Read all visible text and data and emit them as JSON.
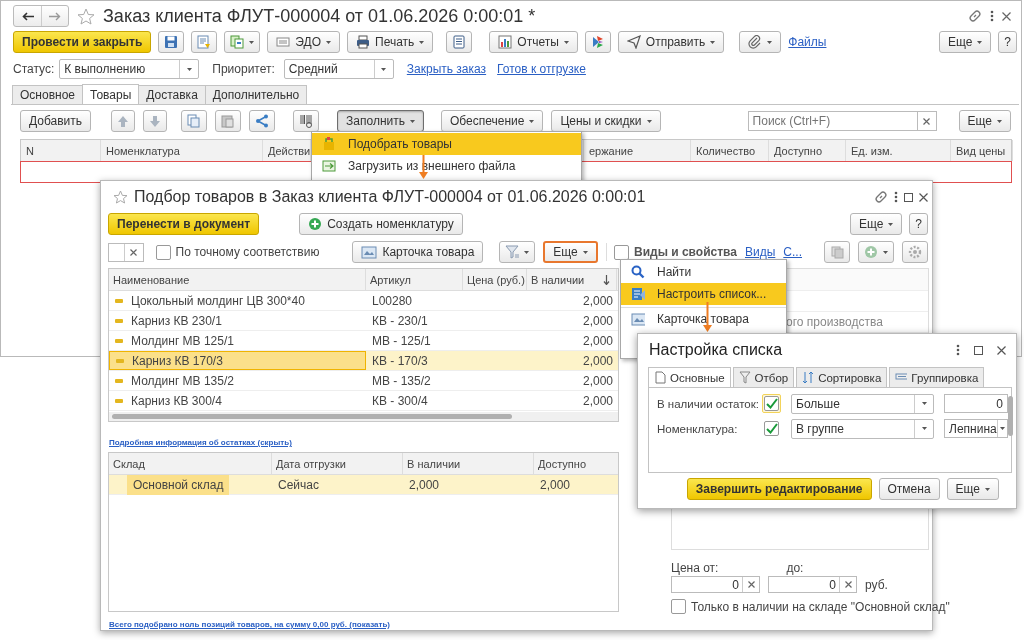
{
  "main": {
    "title": "Заказ клиента ФЛУТ-000004 от 01.06.2026 0:00:01 *",
    "toolbar": {
      "post": "Провести и закрыть",
      "edo": "ЭДО",
      "print": "Печать",
      "reports": "Отчеты",
      "send": "Отправить",
      "files": "Файлы",
      "more": "Еще",
      "help": "?"
    },
    "status": {
      "label": "Статус:",
      "value": "К выполнению"
    },
    "priority": {
      "label": "Приоритет:",
      "value": "Средний"
    },
    "links": [
      "Закрыть заказ",
      "Готов к отгрузке"
    ],
    "tabs": [
      {
        "label": "Основное",
        "selected": false
      },
      {
        "label": "Товары",
        "selected": true
      },
      {
        "label": "Доставка",
        "selected": false
      },
      {
        "label": "Дополнительно",
        "selected": false
      }
    ],
    "goods_toolbar": {
      "add": "Добавить",
      "fill": {
        "label": "Заполнить",
        "pressed": true
      },
      "supply": "Обеспечение",
      "prices": "Цены и скидки",
      "search_placeholder": "Поиск (Ctrl+F)",
      "more": "Еще"
    },
    "columns": [
      "N",
      "Номенклатура",
      "Действи",
      "ержание",
      "Количество",
      "Доступно",
      "Ед. изм.",
      "Вид цены"
    ]
  },
  "fill_menu": [
    {
      "label": "Подобрать товары",
      "selected": true
    },
    {
      "label": "Загрузить из внешнего файла",
      "selected": false
    }
  ],
  "picker": {
    "title": "Подбор товаров в Заказ клиента ФЛУТ-000004 от 01.06.2026 0:00:01",
    "transfer": "Перенести в документ",
    "create": "Создать номенклатуру",
    "more": "Еще",
    "help": "?",
    "exact_match": {
      "label": "По точному соответствию",
      "checked": false
    },
    "card": "Карточка товара",
    "list_more": {
      "label": "Еще",
      "pressed": true
    },
    "kinds": {
      "label": "Виды и свойства",
      "checked": false
    },
    "kinds_links": [
      "Виды",
      "С..."
    ],
    "columns": [
      "Наименование",
      "Артикул",
      "Цена (руб.)",
      "В наличии"
    ],
    "rows": [
      {
        "name": "Цокольный молдинг ЦВ 300*40",
        "article": "L00280",
        "stock": "2,000",
        "selected": false
      },
      {
        "name": "Карниз КВ 230/1",
        "article": "КВ - 230/1",
        "stock": "2,000",
        "selected": false
      },
      {
        "name": "Молдинг МВ 125/1",
        "article": "МВ - 125/1",
        "stock": "2,000",
        "selected": false
      },
      {
        "name": "Карниз КВ 170/3",
        "article": "КВ - 170/3",
        "stock": "2,000",
        "selected": true
      },
      {
        "name": "Молдинг МВ 135/2",
        "article": "МВ - 135/2",
        "stock": "2,000",
        "selected": false
      },
      {
        "name": "Карниз КВ 300/4",
        "article": "КВ - 300/4",
        "stock": "2,000",
        "selected": false
      }
    ],
    "stock_link": "Подробная информация об остатках (скрыть)",
    "stock_columns": [
      "Склад",
      "Дата отгрузки",
      "В наличии",
      "Доступно"
    ],
    "stock_rows": [
      {
        "cells": [
          "Основной склад",
          "Сейчас",
          "2,000",
          "2,000"
        ],
        "selected": true
      }
    ],
    "total_link": "Всего подобрано ноль позиций товаров, на сумму 0,00 руб. (показать)",
    "properties_text": "ого производства",
    "price_from": {
      "label": "Цена от:",
      "value": "0"
    },
    "price_to": {
      "label": "до:",
      "value": "0"
    },
    "currency": "руб.",
    "only_in_stock": {
      "label": "Только в наличии на складе \"Основной склад\"",
      "checked": false
    }
  },
  "more_menu": [
    {
      "label": "Найти",
      "selected": false
    },
    {
      "label": "Настроить список...",
      "selected": true
    },
    {
      "label": "Карточка товара",
      "selected": false
    }
  ],
  "settings": {
    "title": "Настройка списка",
    "tabs": [
      {
        "label": "Основные",
        "selected": true
      },
      {
        "label": "Отбор",
        "selected": false
      },
      {
        "label": "Сортировка",
        "selected": false
      },
      {
        "label": "Группировка",
        "selected": false
      }
    ],
    "rows": [
      {
        "label": "В наличии остаток:",
        "checked": true,
        "focused": true,
        "condition": "Больше",
        "kind": "number",
        "value": "0"
      },
      {
        "label": "Номенклатура:",
        "checked": true,
        "focused": false,
        "condition": "В группе",
        "kind": "choice",
        "value": "Лепнина"
      }
    ],
    "finish": "Завершить редактирование",
    "cancel": "Отмена",
    "more": "Еще"
  }
}
